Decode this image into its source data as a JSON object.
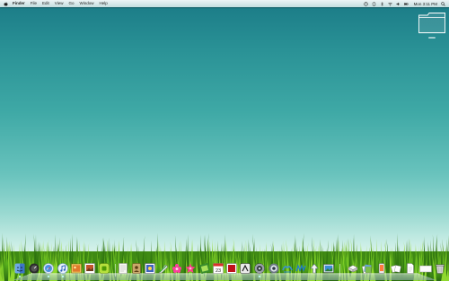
{
  "menubar": {
    "app_name": "Finder",
    "items": [
      "File",
      "Edit",
      "View",
      "Go",
      "Window",
      "Help"
    ],
    "clock": "Mon 3:11 PM"
  },
  "icons": {
    "apple": "apple-icon",
    "status": [
      "time-machine-icon",
      "sync-icon",
      "bluetooth-icon",
      "wifi-icon",
      "volume-icon",
      "battery-icon"
    ],
    "search": "spotlight-icon",
    "desktop_folder": "folder-icon"
  },
  "dock": {
    "apps": [
      "finder",
      "dashboard",
      "safari",
      "itunes",
      "iphoto",
      "preview-pictures",
      "app-green",
      "textedit",
      "contacts",
      "iphoto-album",
      "quicktime",
      "pages",
      "photo-booth",
      "ical",
      "app-red",
      "app-dark",
      "system-preferences",
      "app-bird",
      "app-blue",
      "preview",
      "app-pinwheel"
    ],
    "stacks": [
      "drive-stack",
      "documents-stack",
      "text-stack",
      "downloads-stack",
      "trash"
    ]
  },
  "colors": {
    "sky_top": "#1a7a86",
    "sky_bottom": "#e2f6ef",
    "grass_dark": "#2a6a12",
    "grass_light": "#9ee02a",
    "menubar": "#f0f6f6"
  }
}
